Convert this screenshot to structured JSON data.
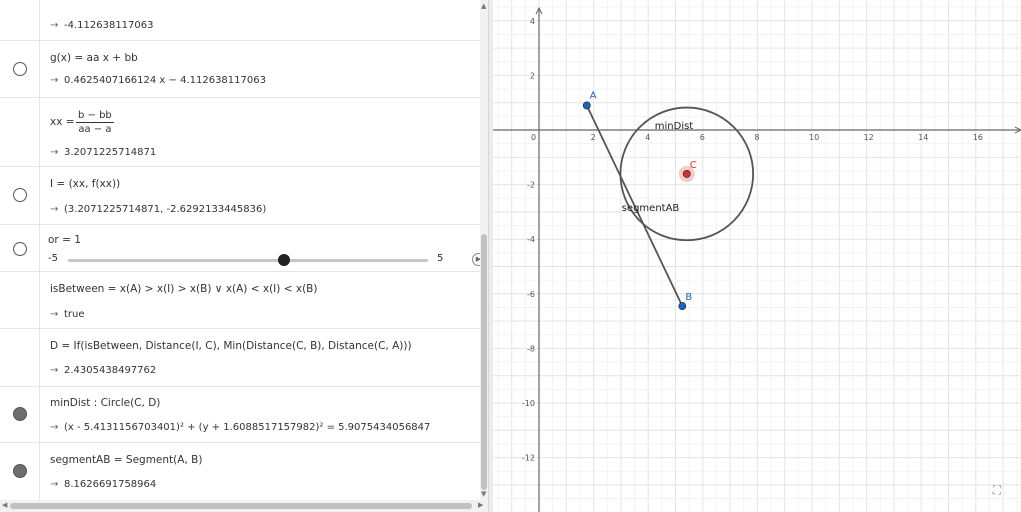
{
  "algebra": {
    "rows": [
      {
        "out": "-4.112638117063"
      },
      {
        "def": "g(x)  =  aa x + bb",
        "out": "0.4625407166124 x − 4.112638117063",
        "visible": false
      },
      {
        "lhs": "xx =",
        "num": "b − bb",
        "den": "aa − a",
        "out": "3.2071225714871"
      },
      {
        "def": "I  =  (xx, f(xx))",
        "out": "(3.2071225714871, -2.6292133445836)",
        "visible": false
      },
      {
        "def": "or = 1",
        "min": "-5",
        "max": "5",
        "value": 1,
        "visible": false
      },
      {
        "def": "isBetween  =  x(A) > x(I) > x(B) ∨ x(A) < x(I) < x(B)",
        "out": "true"
      },
      {
        "def": "D  =  If(isBetween, Distance(I, C), Min(Distance(C, B), Distance(C, A)))",
        "out": "2.4305438497762"
      },
      {
        "def": "minDist : Circle(C, D)",
        "out": "(x - 5.4131156703401)² + (y + 1.6088517157982)² = 5.9075434056847",
        "visible": true
      },
      {
        "def": "segmentAB  =  Segment(A, B)",
        "out": "8.1626691758964",
        "visible": true
      }
    ],
    "output_arrow": "→",
    "play_icon": "play-icon"
  },
  "graphics": {
    "x_ticks": [
      "0",
      "2",
      "4",
      "6",
      "8",
      "10",
      "12",
      "14",
      "16"
    ],
    "y_ticks": [
      "4",
      "2",
      "0",
      "-2",
      "-4",
      "-6",
      "-8",
      "-10",
      "-12"
    ],
    "points": [
      {
        "name": "A",
        "x": 1.75,
        "y": 0.9,
        "color": "#1565c0"
      },
      {
        "name": "B",
        "x": 5.25,
        "y": -6.45,
        "color": "#1565c0"
      },
      {
        "name": "C",
        "x": 5.4131156703401,
        "y": -1.6088517157982,
        "color": "#d32f2f"
      }
    ],
    "circle": {
      "label": "minDist",
      "radius": 2.4305438497762
    },
    "segment": {
      "label": "segmentAB"
    },
    "colors": {
      "axis": "#666666",
      "grid": "#e4e4e4",
      "minor_grid": "#f3f3f3",
      "object": "#555555"
    },
    "fullscreen_icon": "fullscreen-icon"
  }
}
